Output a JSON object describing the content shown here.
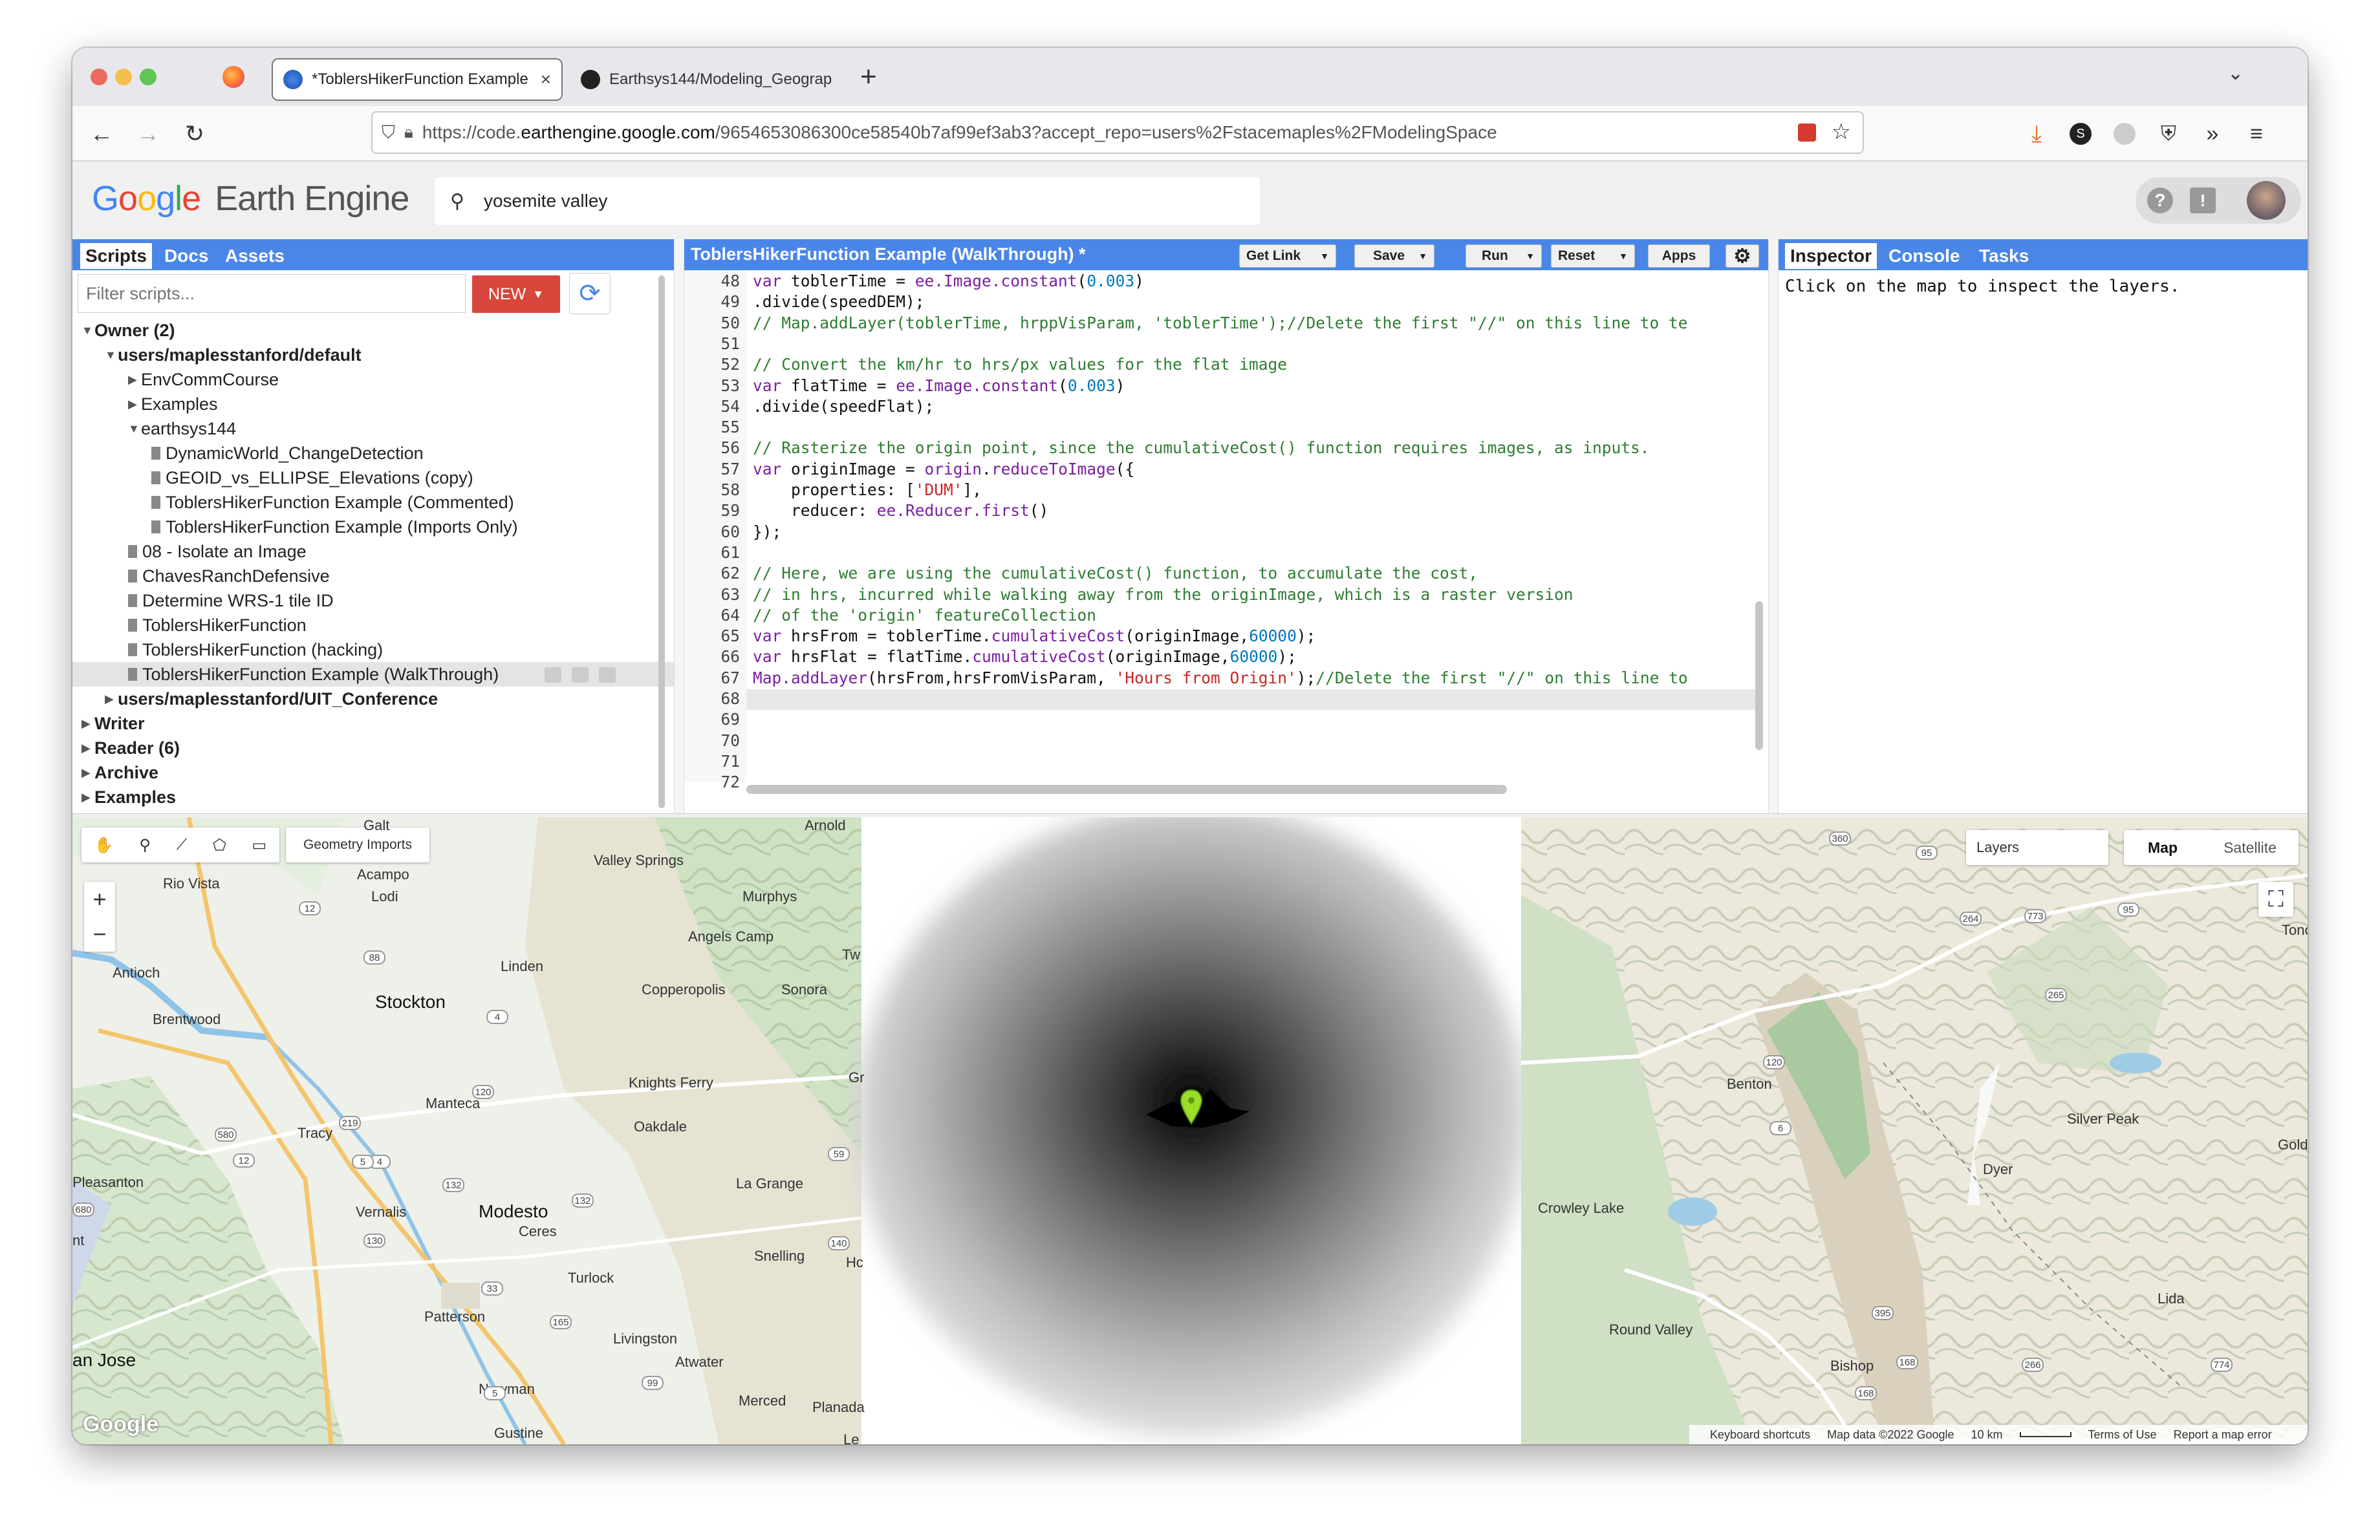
{
  "browser": {
    "tabs": [
      {
        "title": "*ToblersHikerFunction Example",
        "active": true
      },
      {
        "title": "Earthsys144/Modeling_Geograp",
        "active": false
      }
    ],
    "url_prefix": "https://code.",
    "url_domain": "earthengine.google.com",
    "url_path": "/9654653086300ce58540b7af99ef3ab3?accept_repo=users%2Fstacemaples%2FModelingSpace"
  },
  "app": {
    "logo_google": "Google",
    "logo_product": "Earth Engine",
    "search_value": "yosemite valley"
  },
  "left_panel": {
    "tabs": [
      "Scripts",
      "Docs",
      "Assets"
    ],
    "filter_placeholder": "Filter scripts...",
    "new_label": "NEW",
    "tree": [
      {
        "label": "Owner (2)",
        "level": 0,
        "kind": "folder",
        "open": true,
        "bold": true
      },
      {
        "label": "users/maplesstanford/default",
        "level": 1,
        "kind": "folder",
        "open": true,
        "bold": true
      },
      {
        "label": "EnvCommCourse",
        "level": 2,
        "kind": "folder",
        "open": false
      },
      {
        "label": "Examples",
        "level": 2,
        "kind": "folder",
        "open": false
      },
      {
        "label": "earthsys144",
        "level": 2,
        "kind": "folder",
        "open": true
      },
      {
        "label": "DynamicWorld_ChangeDetection",
        "level": 3,
        "kind": "file"
      },
      {
        "label": "GEOID_vs_ELLIPSE_Elevations (copy)",
        "level": 3,
        "kind": "file"
      },
      {
        "label": "ToblersHikerFunction Example (Commented)",
        "level": 3,
        "kind": "file"
      },
      {
        "label": "ToblersHikerFunction Example (Imports Only)",
        "level": 3,
        "kind": "file"
      },
      {
        "label": "08 - Isolate an Image",
        "level": 2,
        "kind": "file"
      },
      {
        "label": "ChavesRanchDefensive",
        "level": 2,
        "kind": "file"
      },
      {
        "label": "Determine WRS-1 tile ID",
        "level": 2,
        "kind": "file"
      },
      {
        "label": "ToblersHikerFunction",
        "level": 2,
        "kind": "file"
      },
      {
        "label": "ToblersHikerFunction (hacking)",
        "level": 2,
        "kind": "file"
      },
      {
        "label": "ToblersHikerFunction Example (WalkThrough)",
        "level": 2,
        "kind": "file",
        "selected": true
      },
      {
        "label": "users/maplesstanford/UIT_Conference",
        "level": 1,
        "kind": "folder",
        "open": false,
        "bold": true
      },
      {
        "label": "Writer",
        "level": 0,
        "kind": "folder",
        "open": false,
        "bold": true
      },
      {
        "label": "Reader (6)",
        "level": 0,
        "kind": "folder",
        "open": false,
        "bold": true
      },
      {
        "label": "Archive",
        "level": 0,
        "kind": "folder",
        "open": false,
        "bold": true
      },
      {
        "label": "Examples",
        "level": 0,
        "kind": "folder",
        "open": false,
        "bold": true
      }
    ]
  },
  "editor": {
    "title": "ToblersHikerFunction Example (WalkThrough) *",
    "buttons": [
      "Get Link",
      "Save",
      "Run",
      "Reset",
      "Apps"
    ],
    "lines": [
      {
        "n": "48",
        "segs": [
          [
            "kw",
            "var"
          ],
          [
            "p",
            " toblerTime = "
          ],
          [
            "fn",
            "ee.Image.constant"
          ],
          [
            "p",
            "("
          ],
          [
            "num",
            "0.003"
          ],
          [
            "p",
            ")"
          ]
        ]
      },
      {
        "n": "49",
        "segs": [
          [
            "p",
            ".divide(speedDEM);"
          ]
        ]
      },
      {
        "n": "50",
        "segs": [
          [
            "cm",
            "// Map.addLayer(toblerTime, hrppVisParam, 'toblerTime');//Delete the first \"//\" on this line to te"
          ]
        ]
      },
      {
        "n": "51",
        "segs": []
      },
      {
        "n": "52",
        "segs": [
          [
            "cm",
            "// Convert the km/hr to hrs/px values for the flat image"
          ]
        ]
      },
      {
        "n": "53",
        "segs": [
          [
            "kw",
            "var"
          ],
          [
            "p",
            " flatTime = "
          ],
          [
            "fn",
            "ee.Image.constant"
          ],
          [
            "p",
            "("
          ],
          [
            "num",
            "0.003"
          ],
          [
            "p",
            ")"
          ]
        ]
      },
      {
        "n": "54",
        "segs": [
          [
            "p",
            ".divide(speedFlat);"
          ]
        ]
      },
      {
        "n": "55",
        "segs": []
      },
      {
        "n": "56",
        "segs": [
          [
            "cm",
            "// Rasterize the origin point, since the cumulativeCost() function requires images, as inputs."
          ]
        ]
      },
      {
        "n": "57",
        "segs": [
          [
            "kw",
            "var"
          ],
          [
            "p",
            " originImage = "
          ],
          [
            "fn",
            "origin"
          ],
          [
            "p",
            "."
          ],
          [
            "fn",
            "reduceToImage"
          ],
          [
            "p",
            "({"
          ]
        ]
      },
      {
        "n": "58",
        "segs": [
          [
            "p",
            "    properties: ["
          ],
          [
            "str",
            "'DUM'"
          ],
          [
            "p",
            "],"
          ]
        ]
      },
      {
        "n": "59",
        "segs": [
          [
            "p",
            "    reducer: "
          ],
          [
            "fn",
            "ee.Reducer.first"
          ],
          [
            "p",
            "()"
          ]
        ]
      },
      {
        "n": "60",
        "segs": [
          [
            "p",
            "});"
          ]
        ]
      },
      {
        "n": "61",
        "segs": []
      },
      {
        "n": "62",
        "segs": [
          [
            "cm",
            "// Here, we are using the cumulativeCost() function, to accumulate the cost,"
          ]
        ]
      },
      {
        "n": "63",
        "segs": [
          [
            "cm",
            "// in hrs, incurred while walking away from the originImage, which is a raster version"
          ]
        ]
      },
      {
        "n": "64",
        "segs": [
          [
            "cm",
            "// of the 'origin' featureCollection"
          ]
        ]
      },
      {
        "n": "65",
        "segs": [
          [
            "kw",
            "var"
          ],
          [
            "p",
            " hrsFrom = toblerTime."
          ],
          [
            "fn",
            "cumulativeCost"
          ],
          [
            "p",
            "(originImage,"
          ],
          [
            "num",
            "60000"
          ],
          [
            "p",
            ");"
          ]
        ]
      },
      {
        "n": "66",
        "segs": [
          [
            "kw",
            "var"
          ],
          [
            "p",
            " hrsFlat = flatTime."
          ],
          [
            "fn",
            "cumulativeCost"
          ],
          [
            "p",
            "(originImage,"
          ],
          [
            "num",
            "60000"
          ],
          [
            "p",
            ");"
          ]
        ]
      },
      {
        "n": "67",
        "segs": [
          [
            "fn",
            "Map.addLayer"
          ],
          [
            "p",
            "(hrsFrom,hrsFromVisParam, "
          ],
          [
            "str",
            "'Hours from Origin'"
          ],
          [
            "p",
            ");"
          ],
          [
            "cm",
            "//Delete the first \"//\" on this line to"
          ]
        ]
      },
      {
        "n": "68",
        "segs": []
      },
      {
        "n": "69",
        "segs": []
      },
      {
        "n": "70",
        "segs": []
      },
      {
        "n": "71",
        "segs": []
      },
      {
        "n": "72",
        "segs": []
      }
    ]
  },
  "right_panel": {
    "tabs": [
      "Inspector",
      "Console",
      "Tasks"
    ],
    "message": "Click on the map to inspect the layers."
  },
  "map": {
    "geometry_imports": "Geometry Imports",
    "layers": "Layers",
    "map_type": [
      "Map",
      "Satellite"
    ],
    "zoom_in": "+",
    "zoom_out": "−",
    "attribution": [
      "Keyboard shortcuts",
      "Map data ©2022 Google",
      "10 km",
      "Terms of Use",
      "Report a map error"
    ],
    "google_mark": "Google",
    "west_places": [
      "Galt",
      "Arnold",
      "Valley Springs",
      "Acampo",
      "Rio Vista",
      "Lodi",
      "Murphys",
      "Angels Camp",
      "Linden",
      "Antioch",
      "Copperopolis",
      "Sonora",
      "Brentwood",
      "Stockton",
      "Tw",
      "Gr",
      "Knights Ferry",
      "Manteca",
      "Oakdale",
      "Tracy",
      "Pleasanton",
      "La Grange",
      "Modesto",
      "Vernalis",
      "Ceres",
      "nt",
      "Snelling",
      "Turlock",
      "Patterson",
      "Hc",
      "Livingston",
      "Atwater",
      "an Jose",
      "Newman",
      "Merced",
      "Planada",
      "Gustine",
      "Le"
    ],
    "east_places": [
      "Tonop",
      "Benton",
      "Silver Peak",
      "Goldfie",
      "Dyer",
      "Crowley Lake",
      "Lida",
      "Round Valley",
      "Bishop"
    ],
    "shields": [
      "12",
      "88",
      "4",
      "12",
      "4",
      "120",
      "219",
      "580",
      "680",
      "5",
      "132",
      "132",
      "130",
      "33",
      "165",
      "99",
      "140",
      "59",
      "5",
      "360",
      "95",
      "95",
      "773",
      "264",
      "120",
      "6",
      "265",
      "395",
      "266",
      "774",
      "168",
      "168"
    ]
  }
}
